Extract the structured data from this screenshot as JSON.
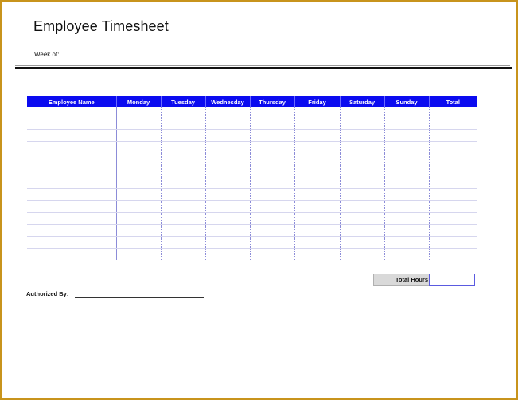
{
  "document": {
    "title": "Employee Timesheet",
    "week_of_label": "Week of:",
    "week_of_value": ""
  },
  "table": {
    "columns": [
      "Employee Name",
      "Monday",
      "Tuesday",
      "Wednesday",
      "Thursday",
      "Friday",
      "Saturday",
      "Sunday",
      "Total"
    ],
    "row_count": 12
  },
  "footer": {
    "total_hours_label": "Total Hours",
    "total_hours_value": "",
    "authorized_by_label": "Authorized By:",
    "authorized_by_value": ""
  },
  "colors": {
    "header_bg": "#0b0bf0",
    "header_text": "#ffffff",
    "frame_border": "#c8941c",
    "total_label_bg": "#d9d9d9"
  }
}
